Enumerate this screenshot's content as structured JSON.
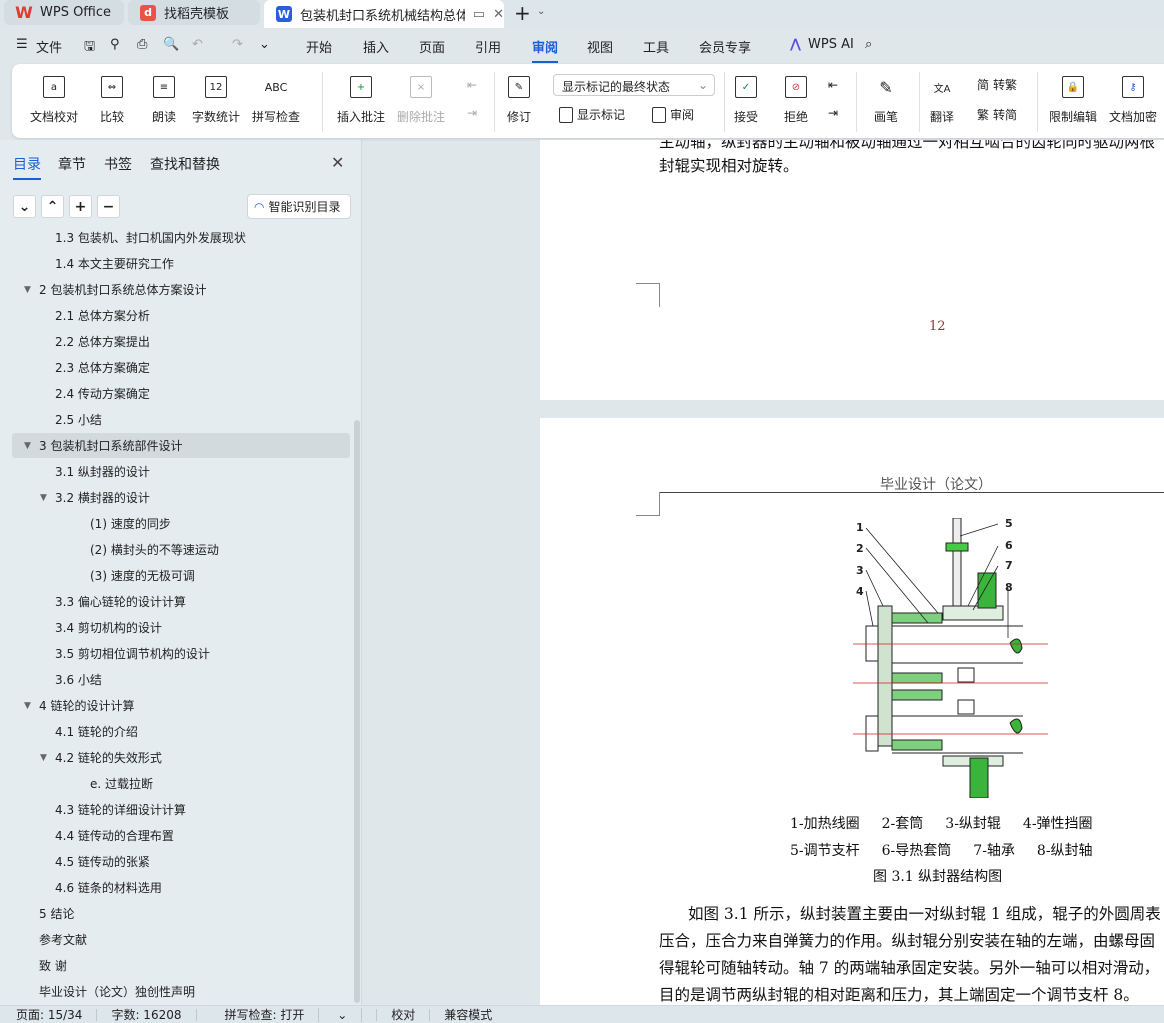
{
  "tabs": [
    {
      "label": "WPS Office"
    },
    {
      "label": "找稻壳模板"
    },
    {
      "label": "包装机封口系统机械结构总体方"
    }
  ],
  "menu": {
    "file": "文件",
    "items": [
      "开始",
      "插入",
      "页面",
      "引用",
      "审阅",
      "视图",
      "工具",
      "会员专享"
    ],
    "active": "审阅",
    "ai": "WPS AI"
  },
  "ribbon": {
    "doc_check": "文档校对",
    "compare": "比较",
    "read_aloud": "朗读",
    "word_count": "字数统计",
    "spell_check": "拼写检查",
    "insert_comment": "插入批注",
    "delete_comment": "删除批注",
    "track": "修订",
    "display_select": "显示标记的最终状态",
    "show_markup": "显示标记",
    "review": "审阅",
    "accept": "接受",
    "reject": "拒绝",
    "pen": "画笔",
    "translate": "翻译",
    "to_trad": "转繁",
    "to_simp": "转简",
    "restrict": "限制编辑",
    "encrypt": "文档加密",
    "abc": "ABC",
    "num12": "12"
  },
  "sidebar": {
    "tabs": [
      "目录",
      "章节",
      "书签",
      "查找和替换"
    ],
    "smart_toc": "智能识别目录",
    "items": [
      {
        "label": "1.3 包装机、封口机国内外发展现状",
        "level": 2
      },
      {
        "label": "1.4 本文主要研究工作",
        "level": 2
      },
      {
        "label": "2   包装机封口系统总体方案设计",
        "level": 1,
        "expanded": true
      },
      {
        "label": "2.1 总体方案分析",
        "level": 2
      },
      {
        "label": "2.2 总体方案提出",
        "level": 2
      },
      {
        "label": "2.3 总体方案确定",
        "level": 2
      },
      {
        "label": "2.4 传动方案确定",
        "level": 2
      },
      {
        "label": "2.5 小结",
        "level": 2
      },
      {
        "label": "3   包装机封口系统部件设计",
        "level": 1,
        "expanded": true,
        "selected": true
      },
      {
        "label": "3.1 纵封器的设计",
        "level": 2
      },
      {
        "label": "3.2 横封器的设计",
        "level": 2,
        "expanded": true
      },
      {
        "label": "(1)   速度的同步",
        "level": 3
      },
      {
        "label": "(2)   横封头的不等速运动",
        "level": 3
      },
      {
        "label": "(3)   速度的无极可调",
        "level": 3
      },
      {
        "label": "3.3 偏心链轮的设计计算",
        "level": 2
      },
      {
        "label": "3.4 剪切机构的设计",
        "level": 2
      },
      {
        "label": "3.5  剪切相位调节机构的设计",
        "level": 2
      },
      {
        "label": "3.6 小结",
        "level": 2
      },
      {
        "label": "4   链轮的设计计算",
        "level": 1,
        "expanded": true
      },
      {
        "label": "4.1  链轮的介绍",
        "level": 2
      },
      {
        "label": "4.2  链轮的失效形式",
        "level": 2,
        "expanded": true
      },
      {
        "label": "e.  过载拉断",
        "level": 3
      },
      {
        "label": "4.3  链轮的详细设计计算",
        "level": 2
      },
      {
        "label": "4.4  链传动的合理布置",
        "level": 2
      },
      {
        "label": "4.5  链传动的张紧",
        "level": 2
      },
      {
        "label": "4.6  链条的材料选用",
        "level": 2
      },
      {
        "label": "5  结论",
        "level": 0
      },
      {
        "label": "参考文献",
        "level": 0
      },
      {
        "label": "致    谢",
        "level": 0
      },
      {
        "label": "毕业设计（论文）独创性声明",
        "level": 0
      }
    ]
  },
  "doc": {
    "page1_lines": [
      "主动轴，纵封器的主动轴和被动轴通过一对相互啮合的齿轮同时驱动两根",
      "封辊实现相对旋转。"
    ],
    "page_number": "12",
    "header": "毕业设计（论文）",
    "figure_labels": [
      "1",
      "2",
      "3",
      "4",
      "5",
      "6",
      "7",
      "8"
    ],
    "legend_row1": [
      "1-加热线圈",
      "2-套筒",
      "3-纵封辊",
      "4-弹性挡圈"
    ],
    "legend_row2": [
      "5-调节支杆",
      "6-导热套筒",
      "7-轴承",
      "8-纵封轴"
    ],
    "caption": "图 3.1  纵封器结构图",
    "body": [
      "如图 3.1 所示，纵封装置主要由一对纵封辊 1 组成，辊子的外圆周表",
      "压合，压合力来自弹簧力的作用。纵封辊分别安装在轴的左端，由螺母固",
      "得辊轮可随轴转动。轴 7 的两端轴承固定安装。另外一轴可以相对滑动，",
      "目的是调节两纵封辊的相对距离和压力，其上端固定一个调节支杆 8。"
    ]
  },
  "status": {
    "page": "页面: 15/34",
    "words": "字数: 16208",
    "spell": "拼写检查: 打开",
    "proof": "校对",
    "compat": "兼容模式"
  }
}
